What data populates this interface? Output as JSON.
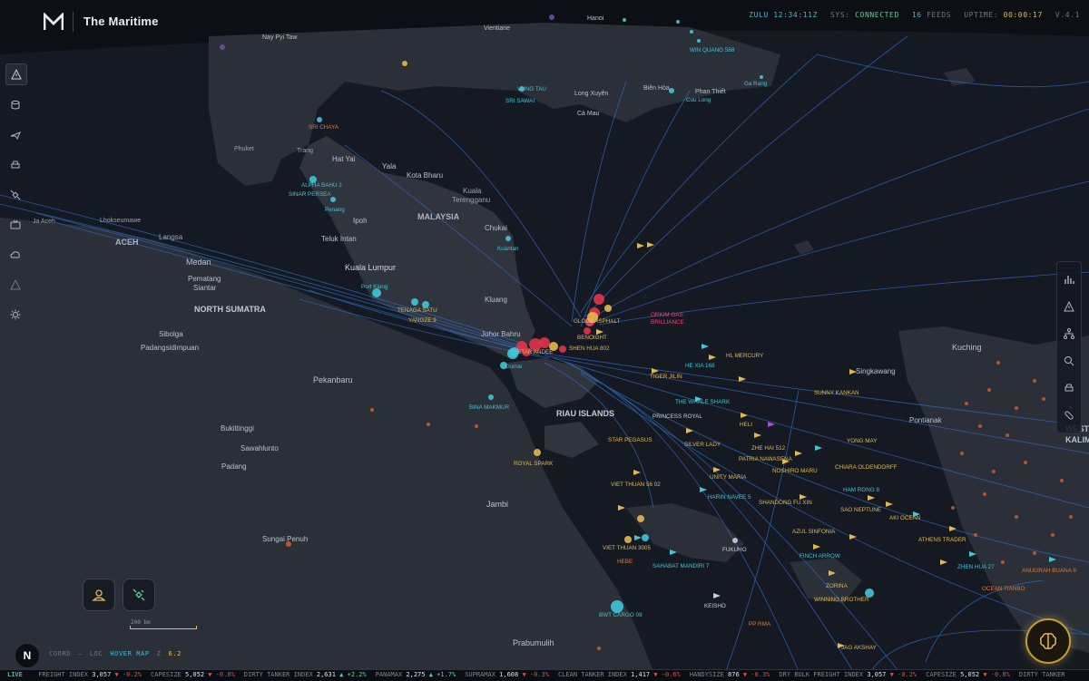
{
  "app": {
    "title": "The Maritime"
  },
  "status": {
    "zulu": "ZULU 12:34:11Z",
    "sys_label": "SYS:",
    "sys_value": "CONNECTED",
    "feeds_count": "16",
    "feeds_label": "FEEDS",
    "uptime_label": "UPTIME:",
    "uptime_value": "00:00:17",
    "version": "V.4.1"
  },
  "left_toolbar": [
    "alert-triangle-icon",
    "database-icon",
    "plane-icon",
    "car-icon",
    "satellite-icon",
    "tv-icon",
    "cloud-icon",
    "warning-icon",
    "gear-icon"
  ],
  "right_toolbar": [
    "bar-chart-icon",
    "warning-icon",
    "network-icon",
    "search-icon",
    "car-icon",
    "pill-icon"
  ],
  "map_labels": [
    {
      "t": "Hanoi",
      "c": "#b9c1cc",
      "s": 7
    },
    {
      "t": "Vientiane",
      "c": "#b9c1cc",
      "s": 7
    },
    {
      "t": "Nay Pyi Taw",
      "c": "#b9c1cc",
      "s": 7
    },
    {
      "t": "Long Xuyên",
      "c": "#b9c1cc",
      "s": 7
    },
    {
      "t": "Biên Hòa",
      "c": "#b9c1cc",
      "s": 7
    },
    {
      "t": "Phan Thiết",
      "c": "#b9c1cc",
      "s": 7
    },
    {
      "t": "Cà Mau",
      "c": "#b9c1cc",
      "s": 7
    },
    {
      "t": "Phuket",
      "c": "#9aa3af",
      "s": 7
    },
    {
      "t": "Trang",
      "c": "#9aa3af",
      "s": 7
    },
    {
      "t": "Hat Yai",
      "c": "#b9c1cc",
      "s": 8
    },
    {
      "t": "Yala",
      "c": "#b9c1cc",
      "s": 8
    },
    {
      "t": "Kota Bharu",
      "c": "#b9c1cc",
      "s": 8
    },
    {
      "t": "Kuala",
      "c": "#9aa3af",
      "s": 8
    },
    {
      "t": "Terengganu",
      "c": "#9aa3af",
      "s": 8
    },
    {
      "t": "MALAYSIA",
      "c": "#aab3bf",
      "s": 9
    },
    {
      "t": "Ipoh",
      "c": "#b9c1cc",
      "s": 8
    },
    {
      "t": "Chukai",
      "c": "#b9c1cc",
      "s": 8
    },
    {
      "t": "Teluk Intan",
      "c": "#b9c1cc",
      "s": 8
    },
    {
      "t": "Kuala Lumpur",
      "c": "#d3d9e1",
      "s": 9
    },
    {
      "t": "Kluang",
      "c": "#b9c1cc",
      "s": 8
    },
    {
      "t": "Johor Bahru",
      "c": "#b9c1cc",
      "s": 8
    },
    {
      "t": "Lhokseumawe",
      "c": "#9aa3af",
      "s": 7
    },
    {
      "t": "ACEH",
      "c": "#aab3bf",
      "s": 9
    },
    {
      "t": "Langsa",
      "c": "#9aa3af",
      "s": 8
    },
    {
      "t": "Medan",
      "c": "#b9c1cc",
      "s": 9
    },
    {
      "t": "Pematang",
      "c": "#b9c1cc",
      "s": 8
    },
    {
      "t": "Siantar",
      "c": "#b9c1cc",
      "s": 8
    },
    {
      "t": "NORTH SUMATRA",
      "c": "#c3cad4",
      "s": 9
    },
    {
      "t": "Sibolga",
      "c": "#b9c1cc",
      "s": 8
    },
    {
      "t": "Padangsidimpuan",
      "c": "#b9c1cc",
      "s": 8
    },
    {
      "t": "Pekanbaru",
      "c": "#b9c1cc",
      "s": 9
    },
    {
      "t": "RIAU ISLANDS",
      "c": "#c3cad4",
      "s": 9
    },
    {
      "t": "Bukittinggi",
      "c": "#b9c1cc",
      "s": 8
    },
    {
      "t": "Sawahlunto",
      "c": "#b9c1cc",
      "s": 8
    },
    {
      "t": "Padang",
      "c": "#b9c1cc",
      "s": 8
    },
    {
      "t": "Jambi",
      "c": "#b9c1cc",
      "s": 9
    },
    {
      "t": "Sungai Penuh",
      "c": "#b9c1cc",
      "s": 8
    },
    {
      "t": "Prabumulih",
      "c": "#b9c1cc",
      "s": 9
    },
    {
      "t": "Kuching",
      "c": "#b9c1cc",
      "s": 9
    },
    {
      "t": "Singkawang",
      "c": "#b9c1cc",
      "s": 8
    },
    {
      "t": "Pontianak",
      "c": "#b9c1cc",
      "s": 8
    },
    {
      "t": "WEST",
      "c": "#b9c1cc",
      "s": 9
    },
    {
      "t": "KALIMAN",
      "c": "#b9c1cc",
      "s": 9
    },
    {
      "t": "Ja Aceh",
      "c": "#9aa3af",
      "s": 7
    }
  ],
  "vessel_labels": [
    {
      "t": "SRI CHAYA",
      "c": "#e07a3a"
    },
    {
      "t": "ALPHA BAHU 2",
      "c": "#3fc6d8"
    },
    {
      "t": "SINAR PERSEA",
      "c": "#3fc6d8"
    },
    {
      "t": "Penang",
      "c": "#3fc6d8"
    },
    {
      "t": "Kuantan",
      "c": "#3fc6d8"
    },
    {
      "t": "Port Klang",
      "c": "#3fc6d8"
    },
    {
      "t": "TENAGA SATU",
      "c": "#e6b84a"
    },
    {
      "t": "YANGZE 9",
      "c": "#e6b84a"
    },
    {
      "t": "GLOBE ASPHALT",
      "c": "#e6b84a"
    },
    {
      "t": "BENOIGHT",
      "c": "#e6b84a"
    },
    {
      "t": "SHEN HUA 802",
      "c": "#e6b84a"
    },
    {
      "t": "STAR ANDEE",
      "c": "#e6b84a"
    },
    {
      "t": "Dumai",
      "c": "#3fc6d8"
    },
    {
      "t": "ORKIM GAS",
      "c": "#e24b7a"
    },
    {
      "t": "BRILLIANCE",
      "c": "#e24b7a"
    },
    {
      "t": "HL MERCURY",
      "c": "#e6b84a"
    },
    {
      "t": "HE XIA 168",
      "c": "#3fc6d8"
    },
    {
      "t": "TIGER JILIN",
      "c": "#e6b84a"
    },
    {
      "t": "SUNNY KANKAN",
      "c": "#e6b84a"
    },
    {
      "t": "THE WHALE SHARK",
      "c": "#3fc6d8"
    },
    {
      "t": "PRINCESS ROYAL",
      "c": "#c9cfd8"
    },
    {
      "t": "HELI",
      "c": "#e6b84a"
    },
    {
      "t": "BINA MAKMUR",
      "c": "#3fc6d8"
    },
    {
      "t": "STAR PEGASUS",
      "c": "#e6b84a"
    },
    {
      "t": "SILVER LADY",
      "c": "#e6b84a"
    },
    {
      "t": "ZHE HAI 512",
      "c": "#e6b84a"
    },
    {
      "t": "YONG MAY",
      "c": "#e6b84a"
    },
    {
      "t": "PATRIA NAWASENA",
      "c": "#e6b84a"
    },
    {
      "t": "NOSHIRO MARU",
      "c": "#e6b84a"
    },
    {
      "t": "CHIARA OLDENDORFF",
      "c": "#e6b84a"
    },
    {
      "t": "ROYAL SPARK",
      "c": "#e6b84a"
    },
    {
      "t": "UNITY MARIA",
      "c": "#e6b84a"
    },
    {
      "t": "VIET THUAN 56 02",
      "c": "#e6b84a"
    },
    {
      "t": "HARIN NAVEE 5",
      "c": "#3fc6d8"
    },
    {
      "t": "HAM RONG 8",
      "c": "#3fc6d8"
    },
    {
      "t": "SHANDONG FU XIN",
      "c": "#e6b84a"
    },
    {
      "t": "SAO NEPTUNE",
      "c": "#e6b84a"
    },
    {
      "t": "AKI OCEAN",
      "c": "#e6b84a"
    },
    {
      "t": "AZUL SINFONIA",
      "c": "#e6b84a"
    },
    {
      "t": "ATHENS TRADER",
      "c": "#e6b84a"
    },
    {
      "t": "VIET THUAN 3005",
      "c": "#e6b84a"
    },
    {
      "t": "FUKUHO",
      "c": "#c9cfd8"
    },
    {
      "t": "FINCH ARROW",
      "c": "#3fc6d8"
    },
    {
      "t": "ZHEN HUA 27",
      "c": "#3fc6d8"
    },
    {
      "t": "ANUGRAH BUANA 9",
      "c": "#e07a3a"
    },
    {
      "t": "HEBE",
      "c": "#e07a3a"
    },
    {
      "t": "SAHABAT MANDIRI 7",
      "c": "#3fc6d8"
    },
    {
      "t": "ZORINA",
      "c": "#e6b84a"
    },
    {
      "t": "OCEAN TIANBO",
      "c": "#e07a3a"
    },
    {
      "t": "WINNING BROTHER",
      "c": "#e6b84a"
    },
    {
      "t": "KEISHO",
      "c": "#c9cfd8"
    },
    {
      "t": "BWT CARGO 09",
      "c": "#3fc6d8"
    },
    {
      "t": "PP RMA",
      "c": "#e07a3a"
    },
    {
      "t": "JAG AKSHAY",
      "c": "#e6b84a"
    },
    {
      "t": "SRI SAWAI",
      "c": "#3fc6d8"
    },
    {
      "t": "VUNG TAU",
      "c": "#3fc6d8"
    },
    {
      "t": "WIN QUANG 588",
      "c": "#3fc6d8"
    },
    {
      "t": "Ga Rang",
      "c": "#3fc6d8"
    },
    {
      "t": "Cuu Long",
      "c": "#3fc6d8"
    }
  ],
  "scale": {
    "label": "200 km"
  },
  "coord": {
    "label": "COORD",
    "dash": "—",
    "loc_label": "LOC",
    "loc_value": "HOVER MAP",
    "zoom_label": "Z",
    "zoom_value": "6.2"
  },
  "ticker": {
    "live": "LIVE",
    "items": [
      {
        "name": "FREIGHT INDEX",
        "value": "3,057",
        "dir": "▼",
        "chg": "-0.2%",
        "up": false
      },
      {
        "name": "CAPESIZE",
        "value": "5,052",
        "dir": "▼",
        "chg": "-0.8%",
        "up": false
      },
      {
        "name": "DIRTY TANKER INDEX",
        "value": "2,631",
        "dir": "▲",
        "chg": "+2.2%",
        "up": true
      },
      {
        "name": "PANAMAX",
        "value": "2,275",
        "dir": "▲",
        "chg": "+1.7%",
        "up": true
      },
      {
        "name": "SUPRAMAX",
        "value": "1,608",
        "dir": "▼",
        "chg": "-0.3%",
        "up": false
      },
      {
        "name": "CLEAN TANKER INDEX",
        "value": "1,417",
        "dir": "▼",
        "chg": "-0.6%",
        "up": false
      },
      {
        "name": "HANDYSIZE",
        "value": "876",
        "dir": "▼",
        "chg": "-0.3%",
        "up": false
      },
      {
        "name": "DRY BULK FREIGHT INDEX",
        "value": "3,057",
        "dir": "▼",
        "chg": "-0.2%",
        "up": false
      },
      {
        "name": "CAPESIZE",
        "value": "5,052",
        "dir": "▼",
        "chg": "-0.8%",
        "up": false
      },
      {
        "name": "DIRTY TANKER",
        "value": "",
        "dir": "",
        "chg": "",
        "up": false
      }
    ]
  },
  "colors": {
    "sea": "#141820",
    "land": "#2a2f38",
    "route": "#2f6fd0",
    "cyan": "#3fc6d8",
    "yellow": "#e6b84a",
    "red": "#e0344a",
    "orange": "#d05a2a"
  }
}
